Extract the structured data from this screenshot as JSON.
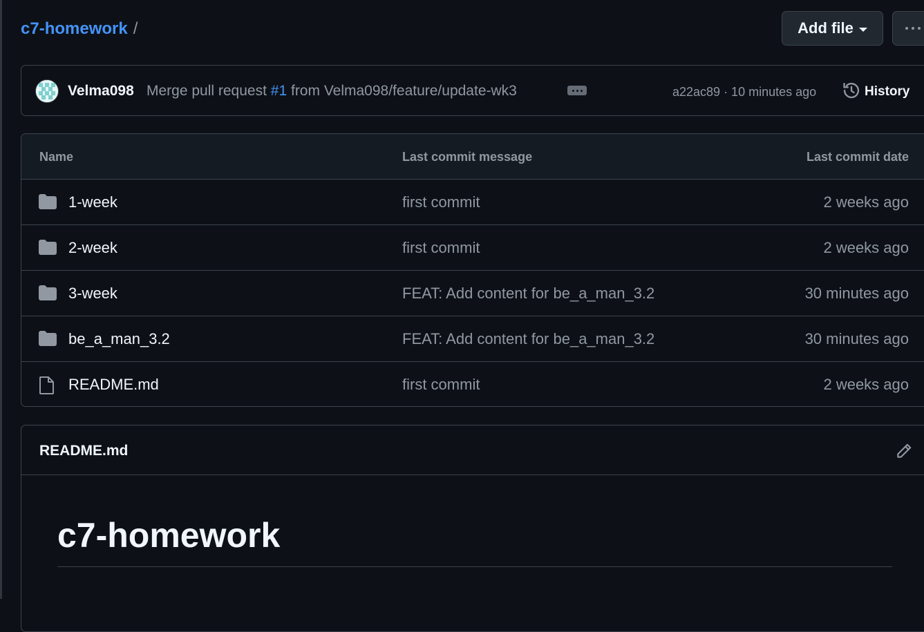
{
  "header": {
    "repo_name": "c7-homework",
    "breadcrumb_separator": "/",
    "add_file_label": "Add file",
    "more_options_icon": "kebab-horizontal-icon"
  },
  "latest_commit": {
    "author": "Velma098",
    "message_prefix": "Merge pull request",
    "pr_ref": "#1",
    "message_suffix": "from Velma098/feature/update-wk3",
    "hash_and_time": "a22ac89 · 10 minutes ago",
    "history_label": "History"
  },
  "file_table": {
    "columns": [
      "Name",
      "Last commit message",
      "Last commit date"
    ],
    "rows": [
      {
        "icon": "folder-icon",
        "name": "1-week",
        "message": "first commit",
        "date": "2 weeks ago"
      },
      {
        "icon": "folder-icon",
        "name": "2-week",
        "message": "first commit",
        "date": "2 weeks ago"
      },
      {
        "icon": "folder-icon",
        "name": "3-week",
        "message": "FEAT: Add content for be_a_man_3.2",
        "date": "30 minutes ago"
      },
      {
        "icon": "folder-icon",
        "name": "be_a_man_3.2",
        "message": "FEAT: Add content for be_a_man_3.2",
        "date": "30 minutes ago"
      },
      {
        "icon": "file-icon",
        "name": "README.md",
        "message": "first commit",
        "date": "2 weeks ago"
      }
    ]
  },
  "readme": {
    "file_name": "README.md",
    "heading": "c7-homework"
  },
  "colors": {
    "background": "#0d1117",
    "link": "#4493f8",
    "border": "#3d444d",
    "muted_text": "#9198a1"
  }
}
